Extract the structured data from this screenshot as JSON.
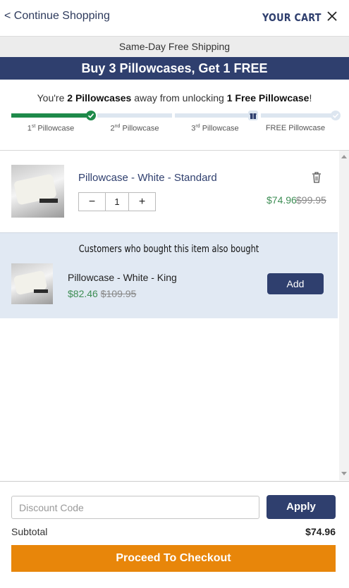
{
  "header": {
    "continue_label": "< Continue Shopping",
    "title": "YOUR CART",
    "close_icon": "close-icon"
  },
  "shipping_banner": "Same-Day Free Shipping",
  "promo_banner": "Buy 3 Pillowcases, Get 1 FREE",
  "progress": {
    "message_pre": "You're ",
    "message_count": "2 Pillowcases",
    "message_mid": " away from unlocking ",
    "message_reward": "1 Free Pillowcase",
    "message_post": "!",
    "steps": [
      {
        "num": "1",
        "sup": "st",
        "label": " Pillowcase"
      },
      {
        "num": "2",
        "sup": "nd",
        "label": " Pillowcase"
      },
      {
        "num": "3",
        "sup": "rd",
        "label": " Pillowcase"
      },
      {
        "num": "",
        "sup": "",
        "label": "FREE Pillowcase"
      }
    ],
    "completed_steps": 1,
    "colors": {
      "fill": "#1e8a4a",
      "track": "#dde6f0"
    }
  },
  "cart_item": {
    "title": "Pillowcase - White - Standard",
    "quantity": "1",
    "minus": "−",
    "plus": "+",
    "sale_price": "$74.96",
    "original_price": "$99.95",
    "remove_icon": "trash-icon"
  },
  "upsell": {
    "heading": "Customers who bought this item also bought",
    "title": "Pillowcase - White - King",
    "sale_price": "$82.46",
    "original_price": "$109.95",
    "add_label": "Add"
  },
  "footer": {
    "discount_placeholder": "Discount Code",
    "apply_label": "Apply",
    "subtotal_label": "Subtotal",
    "subtotal_value": "$74.96",
    "checkout_label": "Proceed To Checkout"
  },
  "colors": {
    "navy": "#2f3f6e",
    "sale_green": "#3e8e55",
    "checkout_orange": "#e8860a",
    "upsell_bg": "#e1e9f3"
  }
}
